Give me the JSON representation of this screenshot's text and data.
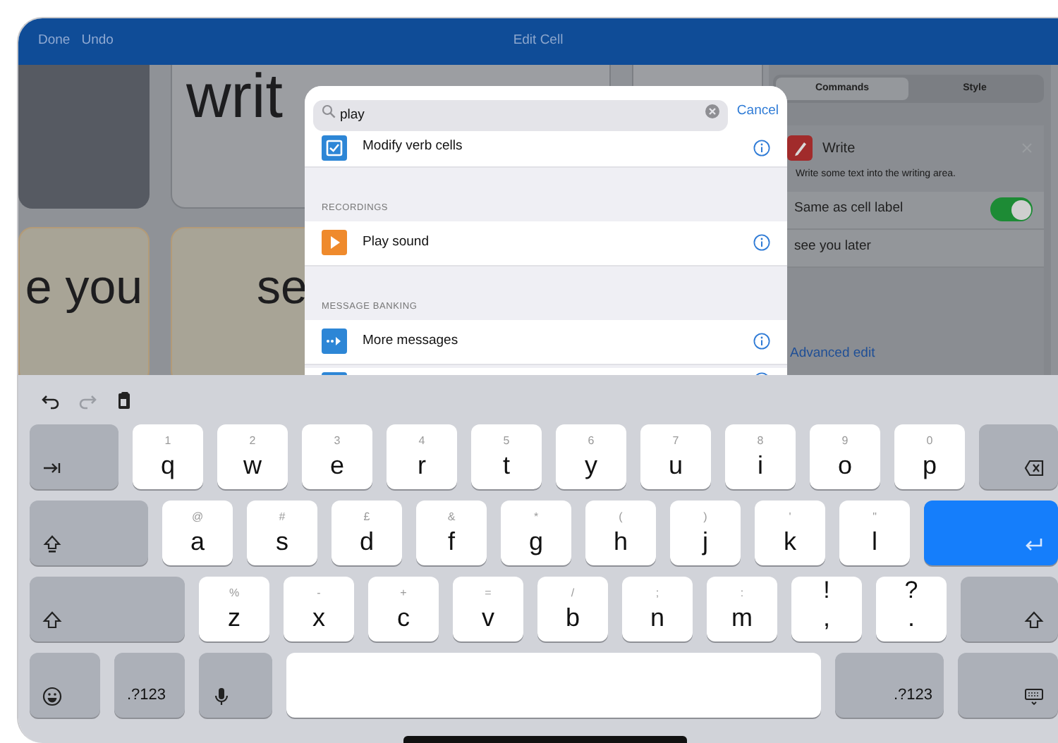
{
  "nav": {
    "buttons": [
      "Done",
      "Undo"
    ],
    "title": "Edit Cell"
  },
  "board": {
    "cells": [
      {
        "kind": "dark"
      },
      {
        "kind": "word",
        "text": "writ"
      },
      {
        "kind": "word"
      },
      {
        "kind": "tan",
        "text": "e you"
      },
      {
        "kind": "tan",
        "text": "se"
      }
    ]
  },
  "popover": {
    "search": {
      "value": "play"
    },
    "cancel": "Cancel",
    "sections": [
      {
        "items": [
          {
            "kind": "check",
            "label": "Modify verb cells"
          }
        ]
      },
      {
        "header": "RECORDINGS",
        "items": [
          {
            "kind": "play",
            "label": "Play sound"
          }
        ]
      },
      {
        "header": "MESSAGE BANKING",
        "items": [
          {
            "kind": "messages",
            "label": "More messages"
          },
          {
            "kind": "blank"
          }
        ]
      }
    ]
  },
  "side_panel": {
    "segments": [
      {
        "label": "Commands",
        "selected": true
      },
      {
        "label": "Style",
        "selected": false
      }
    ],
    "command": {
      "title": "Write",
      "description": "Write some text into the writing area.",
      "options": [
        {
          "kind": "toggle",
          "label": "Same as cell label",
          "on": true
        },
        {
          "kind": "text",
          "label": "see you later"
        }
      ],
      "link": "Advanced edit"
    }
  },
  "keyboard": {
    "toolbar": [
      {
        "kind": "undo",
        "disabled": false
      },
      {
        "kind": "redo",
        "disabled": true
      },
      {
        "kind": "paste",
        "disabled": false
      }
    ],
    "rows": [
      {
        "keys": [
          {
            "kind": "tab"
          },
          {
            "kind": "letter",
            "alt": "1",
            "main": "q"
          },
          {
            "kind": "letter",
            "alt": "2",
            "main": "w"
          },
          {
            "kind": "letter",
            "alt": "3",
            "main": "e"
          },
          {
            "kind": "letter",
            "alt": "4",
            "main": "r"
          },
          {
            "kind": "letter",
            "alt": "5",
            "main": "t"
          },
          {
            "kind": "letter",
            "alt": "6",
            "main": "y"
          },
          {
            "kind": "letter",
            "alt": "7",
            "main": "u"
          },
          {
            "kind": "letter",
            "alt": "8",
            "main": "i"
          },
          {
            "kind": "letter",
            "alt": "9",
            "main": "o"
          },
          {
            "kind": "letter",
            "alt": "0",
            "main": "p"
          },
          {
            "kind": "backspace"
          }
        ]
      },
      {
        "keys": [
          {
            "kind": "caps"
          },
          {
            "kind": "letter",
            "alt": "@",
            "main": "a"
          },
          {
            "kind": "letter",
            "alt": "#",
            "main": "s"
          },
          {
            "kind": "letter",
            "alt": "£",
            "main": "d"
          },
          {
            "kind": "letter",
            "alt": "&",
            "main": "f"
          },
          {
            "kind": "letter",
            "alt": "*",
            "main": "g"
          },
          {
            "kind": "letter",
            "alt": "(",
            "main": "h"
          },
          {
            "kind": "letter",
            "alt": ")",
            "main": "j"
          },
          {
            "kind": "letter",
            "alt": "'",
            "main": "k"
          },
          {
            "kind": "letter",
            "alt": "\"",
            "main": "l"
          },
          {
            "kind": "return"
          }
        ]
      },
      {
        "keys": [
          {
            "kind": "shift"
          },
          {
            "kind": "letter",
            "alt": "%",
            "main": "z"
          },
          {
            "kind": "letter",
            "alt": "-",
            "main": "x"
          },
          {
            "kind": "letter",
            "alt": "+",
            "main": "c"
          },
          {
            "kind": "letter",
            "alt": "=",
            "main": "v"
          },
          {
            "kind": "letter",
            "alt": "/",
            "main": "b"
          },
          {
            "kind": "letter",
            "alt": ";",
            "main": "n"
          },
          {
            "kind": "letter",
            "alt": ":",
            "main": "m"
          },
          {
            "kind": "punct",
            "alt": "!",
            "main": ","
          },
          {
            "kind": "punct",
            "alt": "?",
            "main": "."
          },
          {
            "kind": "shift"
          }
        ]
      },
      {
        "keys": [
          {
            "kind": "emoji"
          },
          {
            "kind": "numbers",
            "main": ".?123"
          },
          {
            "kind": "mic"
          },
          {
            "kind": "space"
          },
          {
            "kind": "numbers",
            "main": ".?123"
          },
          {
            "kind": "hide"
          }
        ]
      }
    ]
  }
}
